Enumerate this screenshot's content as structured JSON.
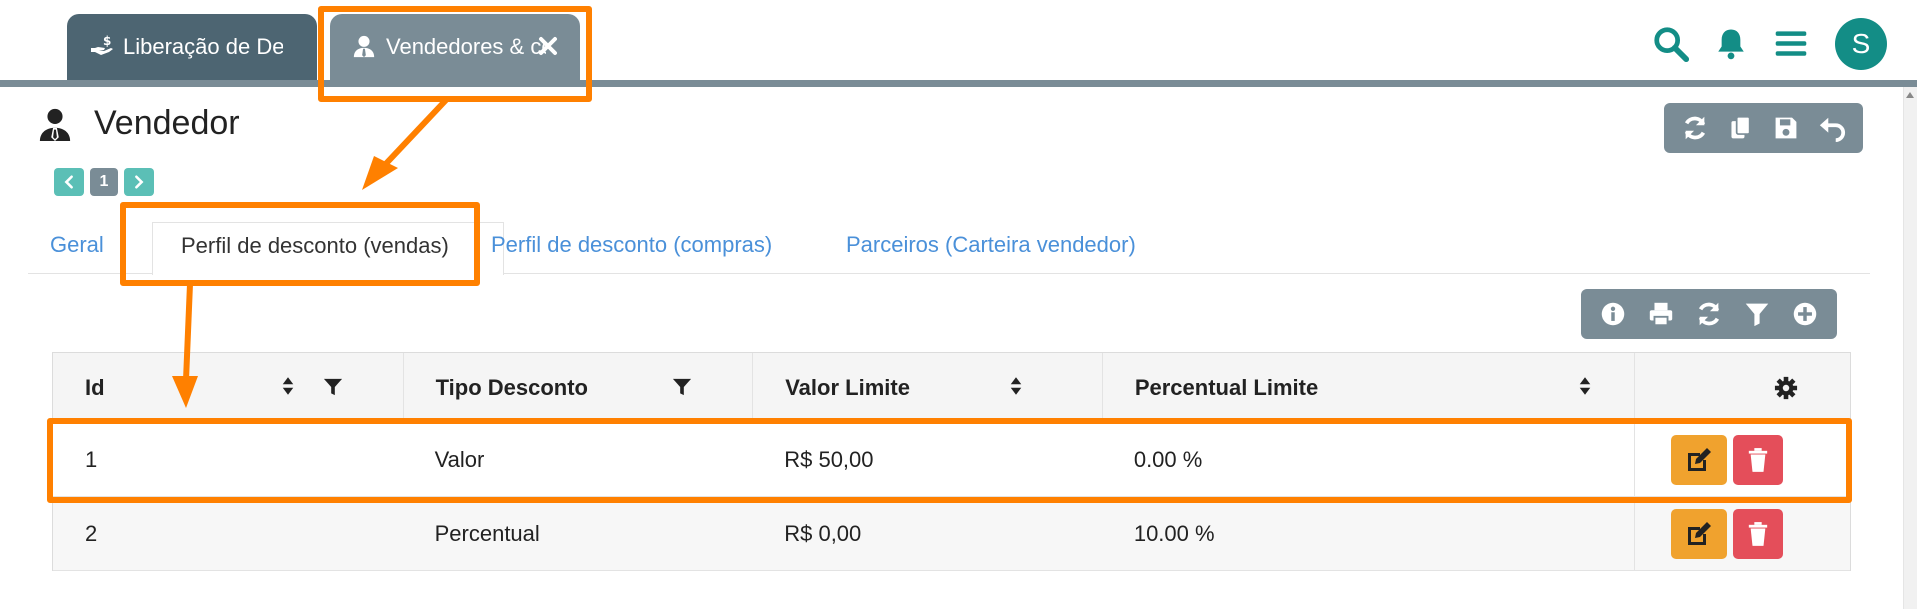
{
  "tabs": [
    {
      "label": "Liberação de De",
      "icon": "hand-money-icon"
    },
    {
      "label": "Vendedores & co",
      "icon": "user-tie-icon"
    }
  ],
  "header_icons": [
    "search-icon",
    "bell-icon",
    "menu-icon"
  ],
  "user": {
    "avatar_letter": "S"
  },
  "page": {
    "title": "Vendedor",
    "icon": "user-tie-icon"
  },
  "pager": {
    "current": "1"
  },
  "top_toolbar": [
    "refresh-icon",
    "copy-icon",
    "save-icon",
    "undo-icon"
  ],
  "subtabs": [
    {
      "label": "Geral"
    },
    {
      "label": "Perfil de desconto (vendas)",
      "active": true
    },
    {
      "label": "Perfil de desconto (compras)"
    },
    {
      "label": "Parceiros (Carteira vendedor)"
    }
  ],
  "table_toolbar": [
    "info-icon",
    "print-icon",
    "refresh-icon",
    "filter-icon",
    "plus-circle-icon"
  ],
  "table": {
    "columns": [
      "Id",
      "Tipo Desconto",
      "Valor Limite",
      "Percentual Limite"
    ],
    "rows": [
      {
        "id": "1",
        "tipo": "Valor",
        "valor": "R$ 50,00",
        "percentual": "0.00 %"
      },
      {
        "id": "2",
        "tipo": "Percentual",
        "valor": "R$ 0,00",
        "percentual": "10.00 %"
      }
    ]
  },
  "colors": {
    "accent": "#138d86",
    "tab_dark": "#4d6572",
    "tab_light": "#7a8c96",
    "link": "#4a90d9",
    "highlight": "#ff8000",
    "edit": "#f0a22e",
    "delete": "#e44e5a"
  }
}
